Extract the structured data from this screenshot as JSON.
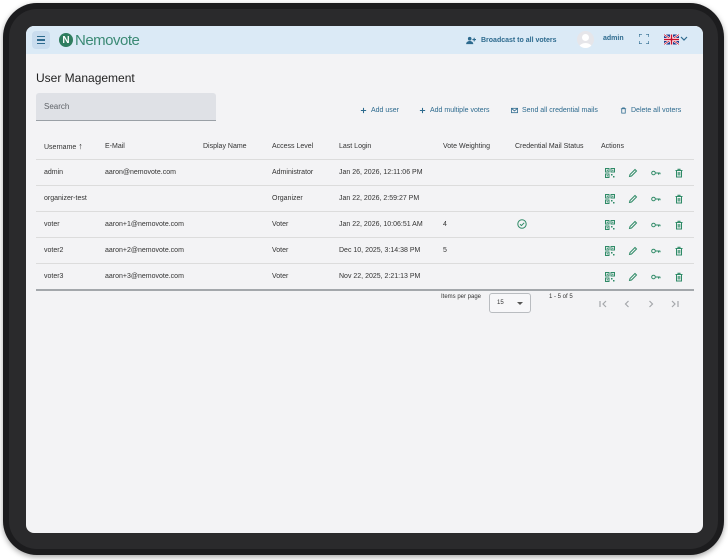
{
  "header": {
    "app_name": "Nemovote",
    "logo_letter": "N",
    "broadcast_label": "Broadcast to all voters",
    "user_name": "admin"
  },
  "page": {
    "title": "User Management",
    "search_placeholder": "Search"
  },
  "toolbar": {
    "add_user": "Add user",
    "add_multiple": "Add multiple voters",
    "send_mails": "Send all credential mails",
    "delete_all": "Delete all voters"
  },
  "table": {
    "columns": [
      "Username",
      "E-Mail",
      "Display Name",
      "Access Level",
      "Last Login",
      "Vote Weighting",
      "Credential Mail Status",
      "Actions"
    ],
    "sort_indicator": "↑",
    "rows": [
      {
        "username": "admin",
        "email": "aaron@nemovote.com",
        "display_name": "",
        "access_level": "Administrator",
        "last_login": "Jan 26, 2026, 12:11:06 PM",
        "vote_weighting": "",
        "mail_sent": false
      },
      {
        "username": "organizer-test",
        "email": "",
        "display_name": "",
        "access_level": "Organizer",
        "last_login": "Jan 22, 2026, 2:59:27 PM",
        "vote_weighting": "",
        "mail_sent": false
      },
      {
        "username": "voter",
        "email": "aaron+1@nemovote.com",
        "display_name": "",
        "access_level": "Voter",
        "last_login": "Jan 22, 2026, 10:06:51 AM",
        "vote_weighting": "4",
        "mail_sent": true
      },
      {
        "username": "voter2",
        "email": "aaron+2@nemovote.com",
        "display_name": "",
        "access_level": "Voter",
        "last_login": "Dec 10, 2025, 3:14:38 PM",
        "vote_weighting": "5",
        "mail_sent": false
      },
      {
        "username": "voter3",
        "email": "aaron+3@nemovote.com",
        "display_name": "",
        "access_level": "Voter",
        "last_login": "Nov 22, 2025, 2:21:13 PM",
        "vote_weighting": "",
        "mail_sent": false
      }
    ]
  },
  "paginator": {
    "items_per_page_label": "Items per page",
    "page_size": "15",
    "range_label": "1 - 5 of 5"
  },
  "colors": {
    "accent": "#2d6a8e",
    "action_icon": "#2e8a66",
    "topbar": "#dbeaf6"
  }
}
